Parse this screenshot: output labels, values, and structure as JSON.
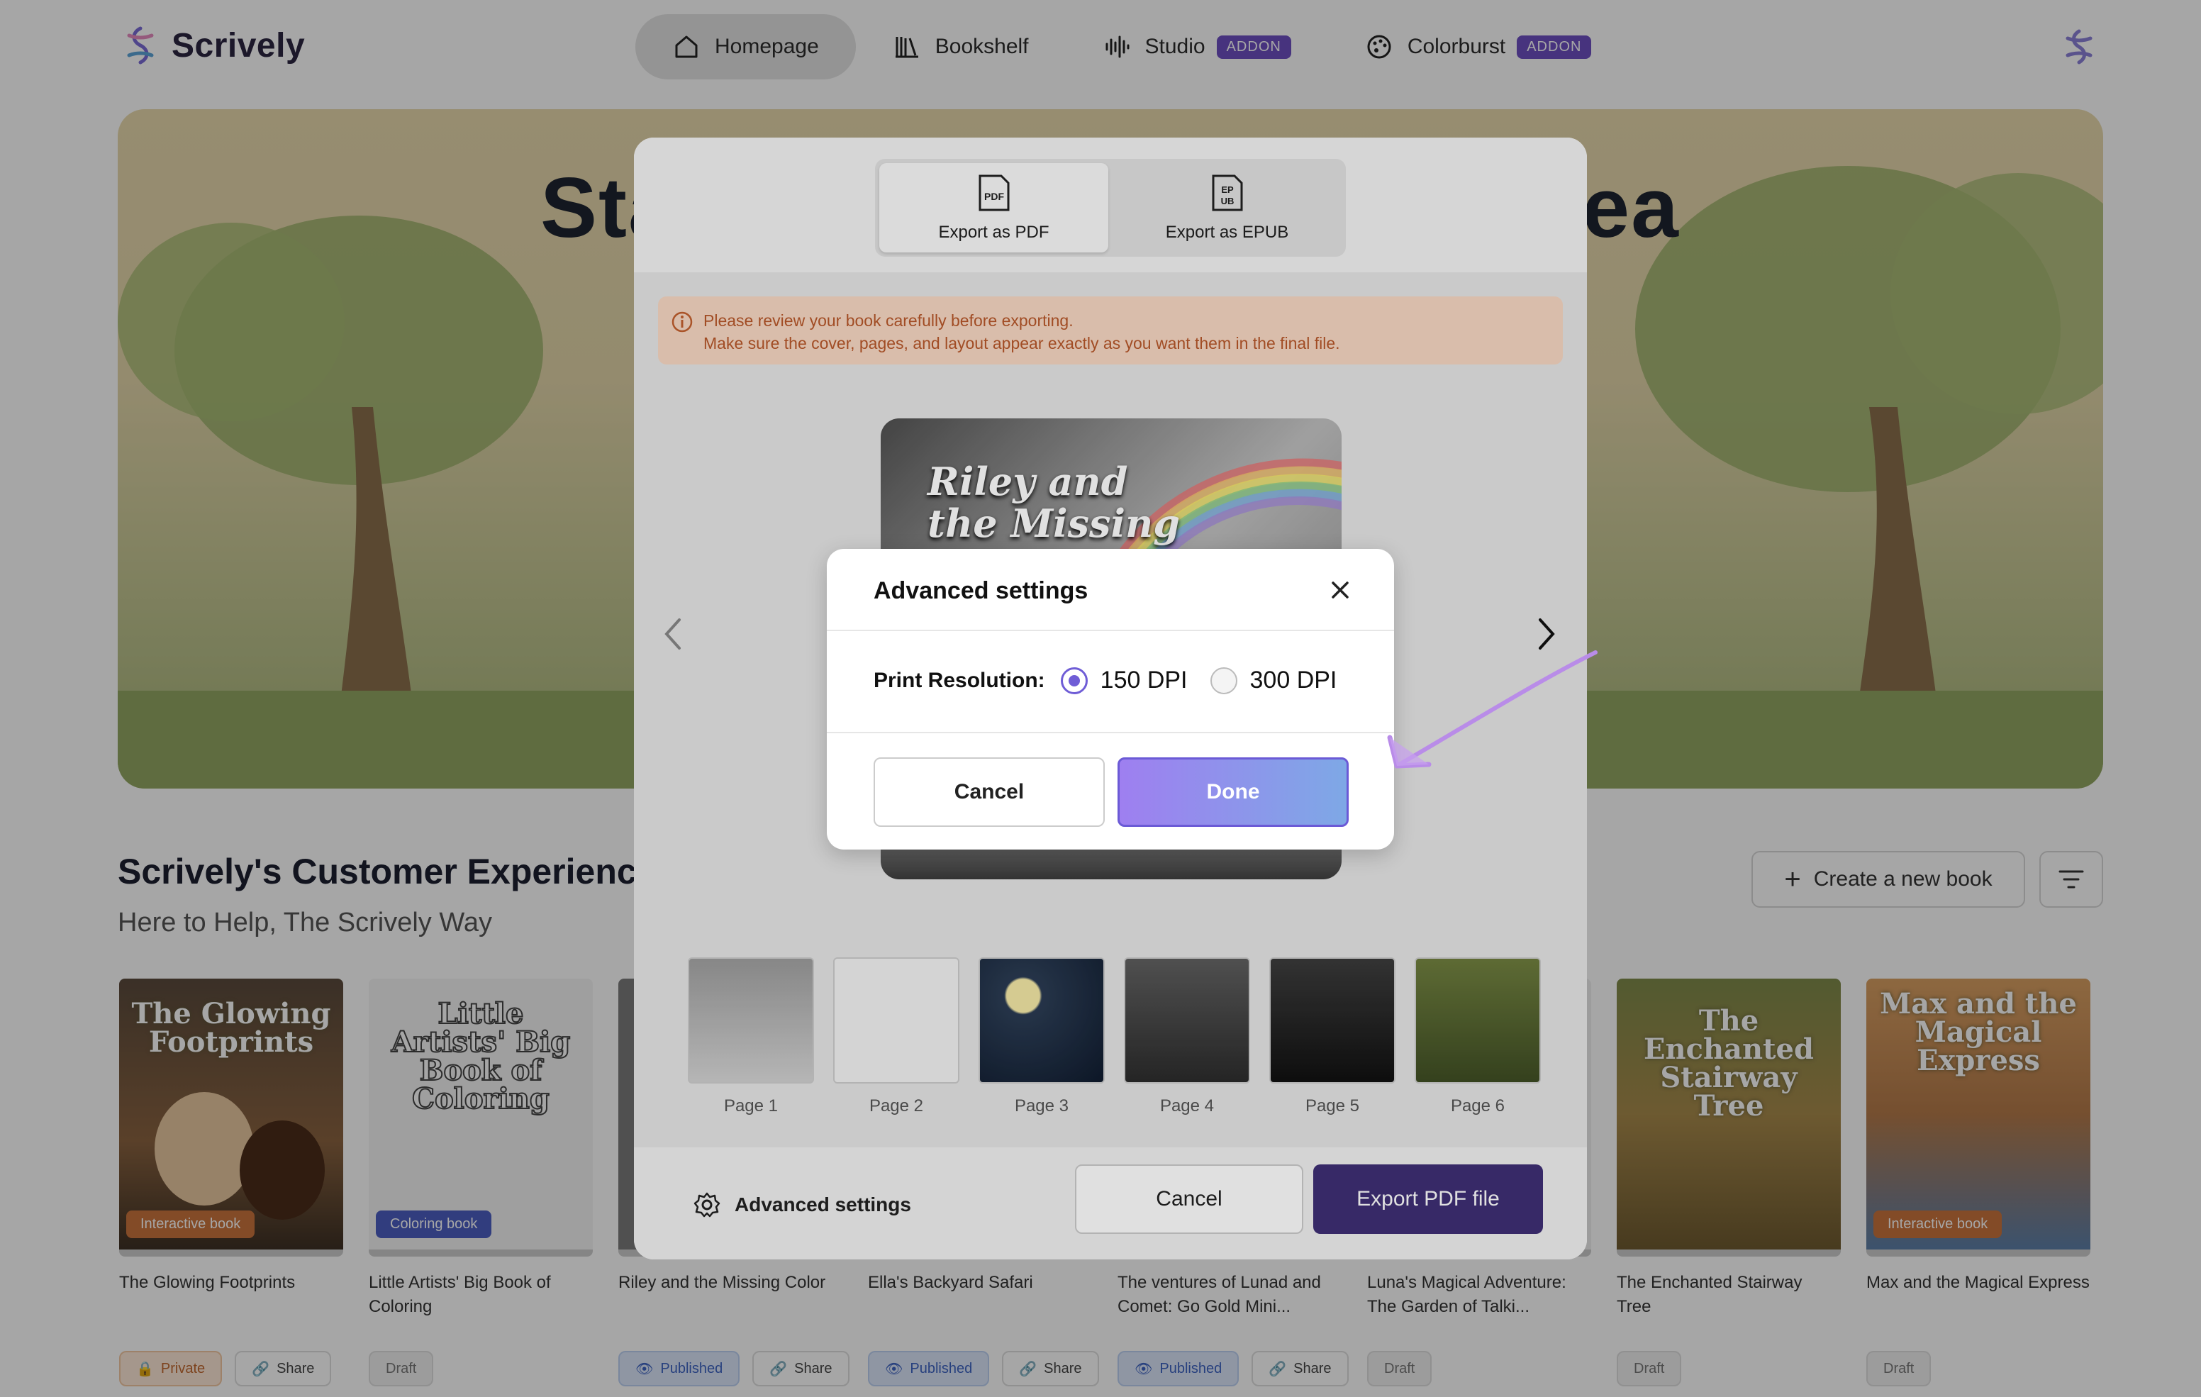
{
  "app": {
    "name": "Scrively"
  },
  "nav": {
    "items": [
      {
        "label": "Homepage",
        "icon": "home-icon",
        "active": true
      },
      {
        "label": "Bookshelf",
        "icon": "bookshelf-icon"
      },
      {
        "label": "Studio",
        "icon": "audio-wave-icon",
        "badge": "ADDON"
      },
      {
        "label": "Colorburst",
        "icon": "palette-icon",
        "badge": "ADDON"
      }
    ]
  },
  "hero": {
    "title_left": "Sta",
    "title_right": "lea"
  },
  "section": {
    "title": "Scrively's Customer Experience T",
    "subtitle": "Here to Help, The Scrively Way",
    "create_label": "Create a new book"
  },
  "books": [
    {
      "title": "The Glowing Footprints",
      "cover_text": "The Glowing Footprints",
      "badge": "Interactive book",
      "tags": [
        "Private",
        "Share"
      ]
    },
    {
      "title": "Little Artists' Big Book of Coloring",
      "cover_text": "Little Artists' Big Book of Coloring",
      "badge": "Coloring book",
      "tags": [
        "Draft"
      ]
    },
    {
      "title": "Riley and the Missing Color",
      "tags": [
        "Published",
        "Share"
      ]
    },
    {
      "title": "Ella's Backyard Safari",
      "tags": [
        "Published",
        "Share"
      ]
    },
    {
      "title": "The ventures of Lunad and Comet: Go Gold Mini...",
      "tags": [
        "Published",
        "Share"
      ]
    },
    {
      "title": "Luna's Magical Adventure: The Garden of Talki...",
      "tags": [
        "Draft"
      ]
    },
    {
      "title": "The Enchanted Stairway Tree",
      "cover_text": "The Enchanted Stairway Tree",
      "tags": [
        "Draft"
      ]
    },
    {
      "title": "Max and the Magical Express",
      "cover_text": "Max and the Magical Express",
      "badge": "Interactive book",
      "tags": [
        "Draft"
      ]
    }
  ],
  "export_modal": {
    "tabs": [
      {
        "label": "Export as PDF",
        "active": true
      },
      {
        "label": "Export as EPUB"
      }
    ],
    "warning_line1": "Please review your book carefully before exporting.",
    "warning_line2": "Make sure the cover, pages, and layout appear exactly as you want them in the final file.",
    "preview_title_line1": "Riley and",
    "preview_title_line2": "the Missing",
    "pages": [
      "Page 1",
      "Page 2",
      "Page 3",
      "Page 4",
      "Page 5",
      "Page 6"
    ],
    "advanced_label": "Advanced settings",
    "cancel_label": "Cancel",
    "export_label": "Export PDF file"
  },
  "advanced_dialog": {
    "title": "Advanced settings",
    "resolution_label": "Print Resolution:",
    "options": [
      "150 DPI",
      "300 DPI"
    ],
    "selected": "150 DPI",
    "cancel_label": "Cancel",
    "done_label": "Done"
  },
  "colors": {
    "brand": "#3f2f76",
    "addon": "#6d4fc2",
    "accent": "#6f5dd6"
  }
}
